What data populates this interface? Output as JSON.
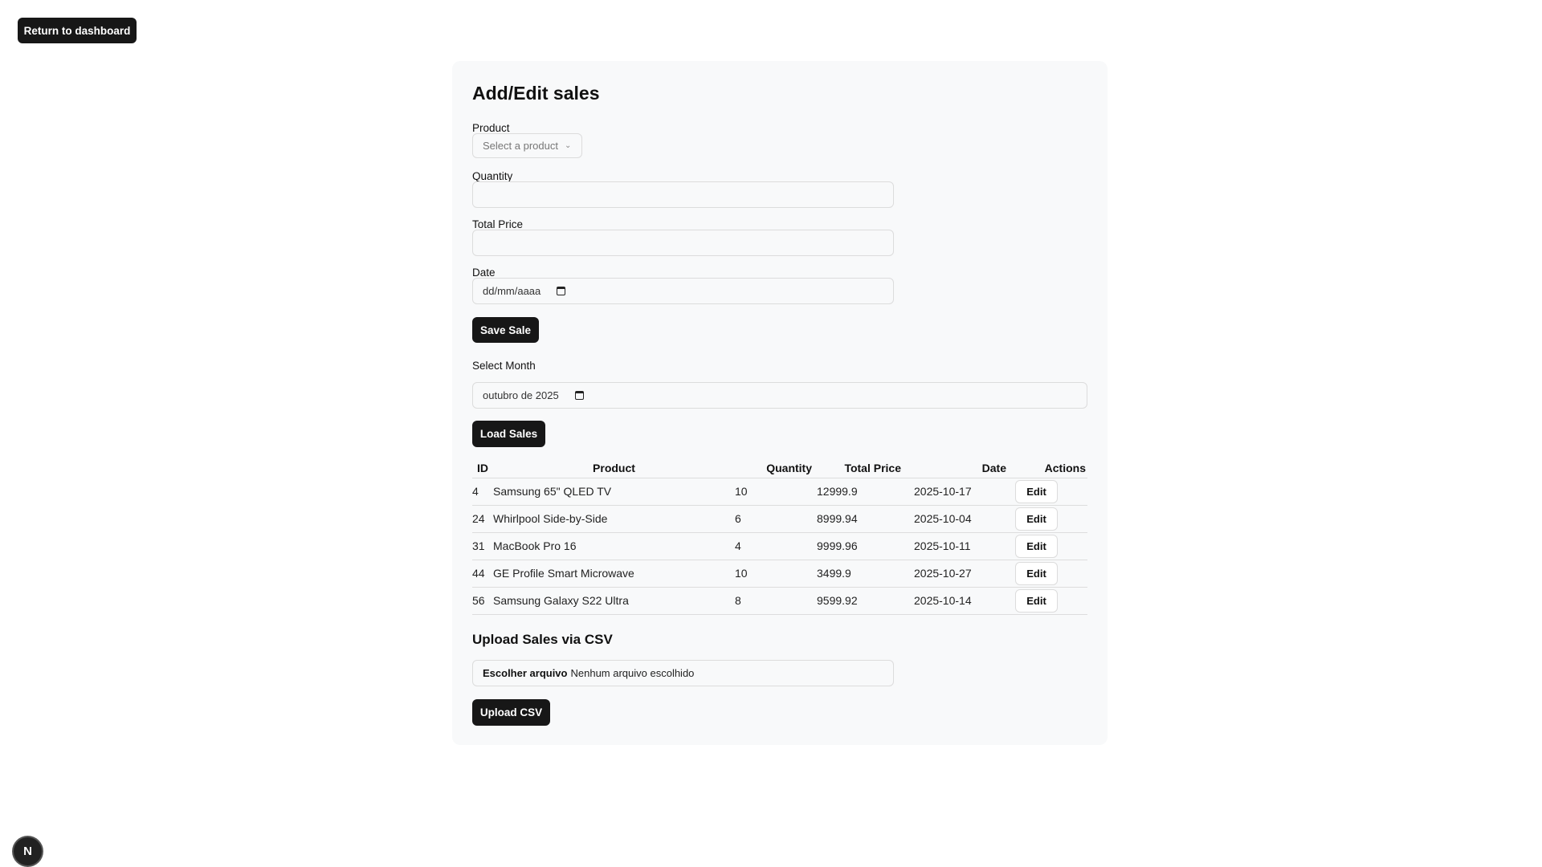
{
  "nav": {
    "back_label": "Return to dashboard"
  },
  "form": {
    "title": "Add/Edit sales",
    "product_label": "Product",
    "product_placeholder": "Select a product",
    "quantity_label": "Quantity",
    "quantity_value": "",
    "total_price_label": "Total Price",
    "total_price_value": "",
    "date_label": "Date",
    "date_placeholder": "dd/mm/aaaa",
    "save_label": "Save Sale"
  },
  "month": {
    "label": "Select Month",
    "value": "outubro de 2025",
    "load_label": "Load Sales"
  },
  "table": {
    "headers": [
      "ID",
      "Product",
      "Quantity",
      "Total Price",
      "Date",
      "Actions"
    ],
    "edit_label": "Edit",
    "rows": [
      {
        "id": "4",
        "product": "Samsung 65\" QLED TV",
        "quantity": "10",
        "total_price": "12999.9",
        "date": "2025-10-17"
      },
      {
        "id": "24",
        "product": "Whirlpool Side-by-Side",
        "quantity": "6",
        "total_price": "8999.94",
        "date": "2025-10-04"
      },
      {
        "id": "31",
        "product": "MacBook Pro 16",
        "quantity": "4",
        "total_price": "9999.96",
        "date": "2025-10-11"
      },
      {
        "id": "44",
        "product": "GE Profile Smart Microwave",
        "quantity": "10",
        "total_price": "3499.9",
        "date": "2025-10-27"
      },
      {
        "id": "56",
        "product": "Samsung Galaxy S22 Ultra",
        "quantity": "8",
        "total_price": "9599.92",
        "date": "2025-10-14"
      }
    ]
  },
  "upload": {
    "title": "Upload Sales via CSV",
    "choose_label": "Escolher arquivo",
    "no_file_text": "Nenhum arquivo escolhido",
    "upload_label": "Upload CSV"
  },
  "badge": {
    "letter": "N"
  }
}
